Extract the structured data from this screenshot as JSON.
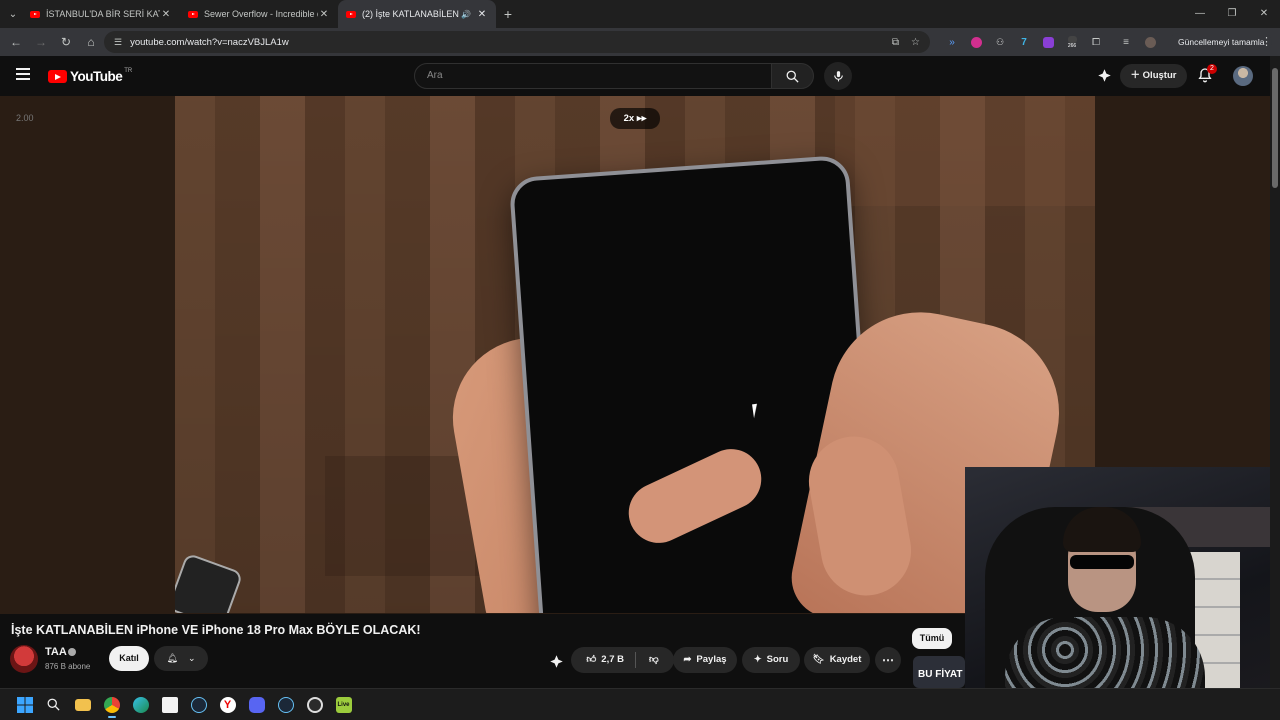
{
  "browser": {
    "tabs": [
      {
        "title": "İSTANBUL'DA BİR SERİ KATİL - ...",
        "active": false
      },
      {
        "title": "Sewer Overflow - Incredible dir...",
        "active": false
      },
      {
        "title": "(2) İşte KATLANABİLEN iPhon...",
        "active": true
      }
    ],
    "url": "youtube.com/watch?v=naczVBJLA1w",
    "update_label": "Güncellemeyi tamamla",
    "extension_badge": "266"
  },
  "youtube": {
    "logo_text": "YouTube",
    "region": "TR",
    "search_placeholder": "Ara",
    "create_label": "Oluştur",
    "notification_count": "2"
  },
  "player": {
    "speed_readout": "2.00",
    "speed_pill": "2x ▸▸",
    "progress": 0.0
  },
  "video": {
    "title": "İşte KATLANABİLEN iPhone VE iPhone 18 Pro Max BÖYLE OLACAK!",
    "channel": "TAA",
    "subscribers": "876 B abone",
    "join_label": "Katıl",
    "likes": "2,7 B",
    "share_label": "Paylaş",
    "ask_label": "Soru",
    "save_label": "Kaydet"
  },
  "sidebar": {
    "chip_all": "Tümü",
    "rec_thumb_text": "BU FİYAT"
  },
  "colors": {
    "brand_red": "#ff0000",
    "background": "#0f0f0f",
    "chip_bg": "#272727"
  }
}
